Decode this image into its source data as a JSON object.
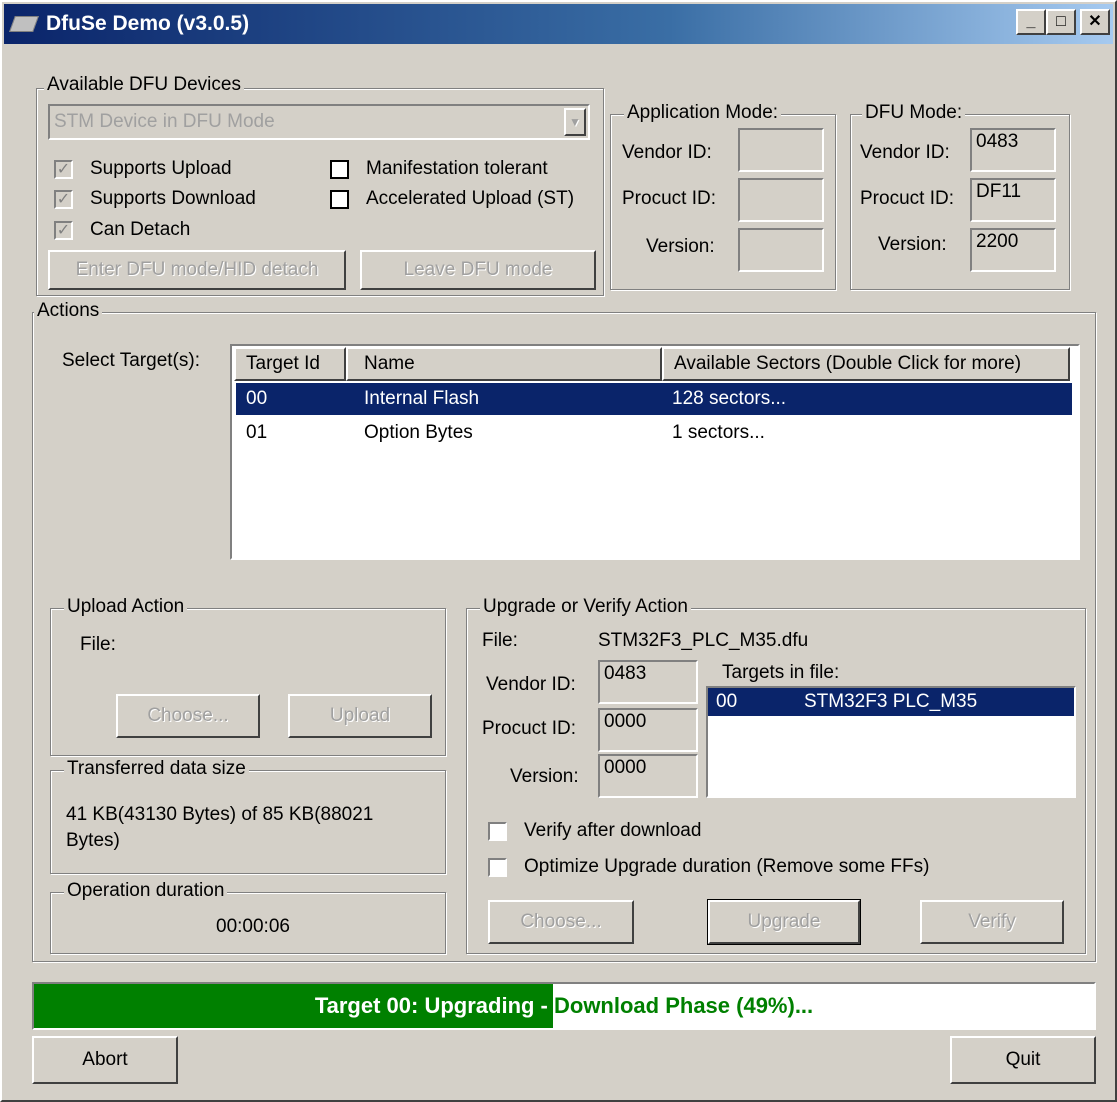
{
  "window": {
    "title": "DfuSe Demo (v3.0.5)"
  },
  "devices": {
    "group_label": "Available DFU Devices",
    "device_select": "STM Device in DFU Mode",
    "checks": [
      {
        "label": "Supports Upload",
        "checked": true
      },
      {
        "label": "Supports Download",
        "checked": true
      },
      {
        "label": "Can Detach",
        "checked": true
      },
      {
        "label": "Manifestation tolerant",
        "checked": false
      },
      {
        "label": "Accelerated Upload (ST)",
        "checked": false
      }
    ],
    "enter_dfu_button": "Enter DFU mode/HID detach",
    "leave_dfu_button": "Leave DFU mode"
  },
  "app_mode": {
    "group_label": "Application Mode:",
    "vendor_label": "Vendor ID:",
    "vendor": "",
    "product_label": "Procuct ID:",
    "product": "",
    "version_label": "Version:",
    "version": ""
  },
  "dfu_mode": {
    "group_label": "DFU Mode:",
    "vendor_label": "Vendor ID:",
    "vendor": "0483",
    "product_label": "Procuct ID:",
    "product": "DF11",
    "version_label": "Version:",
    "version": "2200"
  },
  "actions": {
    "group_label": "Actions",
    "select_target_label": "Select Target(s):",
    "columns": [
      "Target Id",
      "Name",
      "Available Sectors (Double Click for more)"
    ],
    "rows": [
      {
        "id": "00",
        "name": "Internal Flash",
        "sectors": "128 sectors...",
        "selected": true
      },
      {
        "id": "01",
        "name": "Option Bytes",
        "sectors": "1 sectors...",
        "selected": false
      }
    ]
  },
  "upload": {
    "group_label": "Upload Action",
    "file_label": "File:",
    "choose_button": "Choose...",
    "upload_button": "Upload"
  },
  "transferred": {
    "group_label": "Transferred data size",
    "text": "41 KB(43130 Bytes) of 85 KB(88021 Bytes)"
  },
  "duration": {
    "group_label": "Operation duration",
    "value": "00:00:06"
  },
  "upgrade": {
    "group_label": "Upgrade or Verify Action",
    "file_label": "File:",
    "file_value": "STM32F3_PLC_M35.dfu",
    "vendor_label": "Vendor ID:",
    "vendor": "0483",
    "product_label": "Procuct ID:",
    "product": "0000",
    "version_label": "Version:",
    "version": "0000",
    "targets_label": "Targets in file:",
    "targets": [
      {
        "id": "00",
        "name": "STM32F3 PLC_M35"
      }
    ],
    "verify_after": {
      "label": "Verify after download",
      "checked": false
    },
    "optimize": {
      "label": "Optimize Upgrade duration (Remove some FFs)",
      "checked": false
    },
    "choose_button": "Choose...",
    "upgrade_button": "Upgrade",
    "verify_button": "Verify"
  },
  "progress": {
    "percent": 49,
    "text": "Target 00: Upgrading - Download Phase (49%)...",
    "fill_color": "#008000"
  },
  "footer": {
    "abort_button": "Abort",
    "quit_button": "Quit"
  }
}
